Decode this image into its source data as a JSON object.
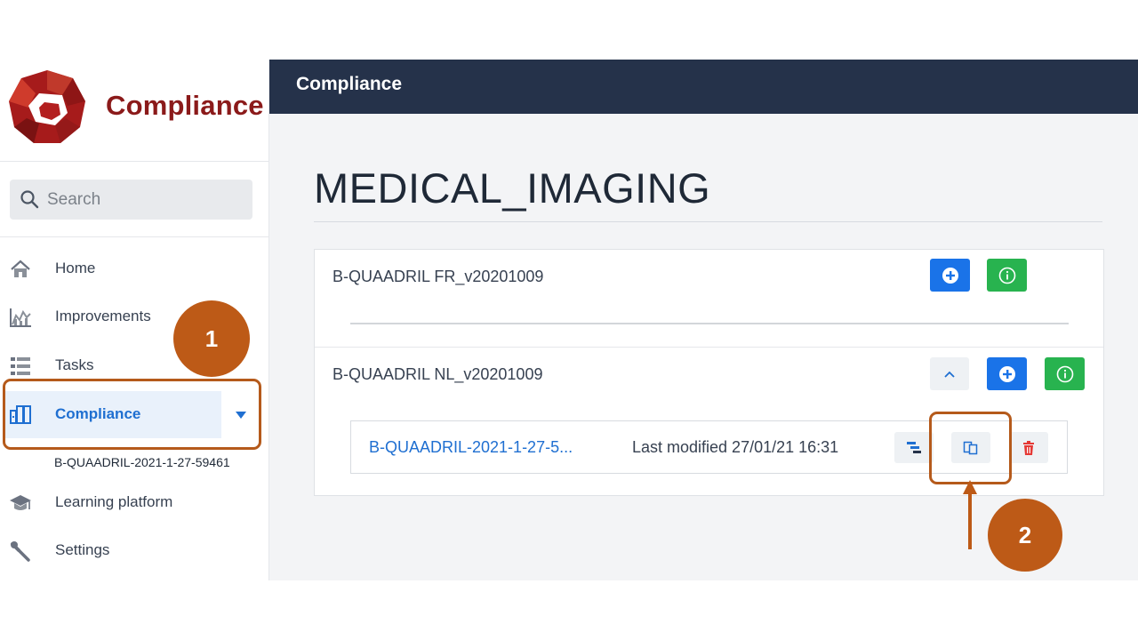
{
  "brand": {
    "name": "Compliance"
  },
  "search": {
    "placeholder": "Search"
  },
  "sidebar": {
    "items": [
      {
        "label": "Home",
        "icon": "home-icon"
      },
      {
        "label": "Improvements",
        "icon": "chart-icon"
      },
      {
        "label": "Tasks",
        "icon": "list-icon"
      },
      {
        "label": "Compliance",
        "icon": "binder-icon",
        "active": true
      },
      {
        "label": "Learning platform",
        "icon": "graduation-cap-icon"
      },
      {
        "label": "Settings",
        "icon": "wrench-icon"
      }
    ],
    "sub_item": "B-QUAADRIL-2021-1-27-59461"
  },
  "topbar": {
    "title": "Compliance"
  },
  "main": {
    "title": "MEDICAL_IMAGING",
    "rows": [
      {
        "label": "B-QUAADRIL FR_v20201009"
      },
      {
        "label": "B-QUAADRIL NL_v20201009"
      }
    ],
    "file": {
      "name": "B-QUAADRIL-2021-1-27-5...",
      "meta": "Last modified 27/01/21 16:31"
    }
  },
  "annotations": {
    "badge1": "1",
    "badge2": "2"
  },
  "colors": {
    "brand": "#8b1a1a",
    "topbar": "#25324a",
    "primary": "#1a73e8",
    "success": "#28b34f",
    "danger": "#e53935",
    "annotation": "#bd5a17"
  }
}
